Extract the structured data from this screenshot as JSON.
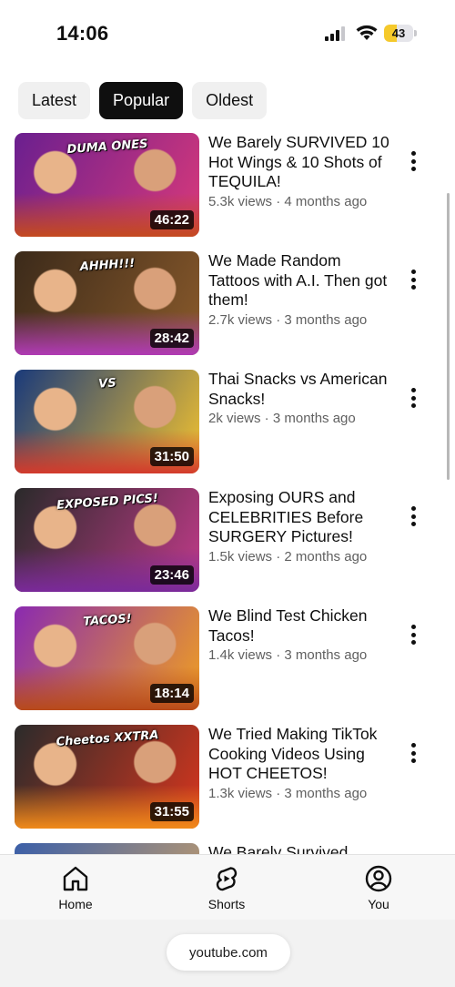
{
  "status_bar": {
    "time": "14:06",
    "battery": "43",
    "battery_level": 0.43
  },
  "chips": [
    {
      "label": "Latest",
      "active": false
    },
    {
      "label": "Popular",
      "active": true
    },
    {
      "label": "Oldest",
      "active": false
    }
  ],
  "videos": [
    {
      "title": "We Barely SURVIVED 10 Hot Wings & 10 Shots of TEQUILA!",
      "stats": "5.3k views · 4 months ago",
      "duration": "46:22",
      "thumb_text": "DUMA ONES",
      "thumb_colors": [
        "#6a1f8f",
        "#d9397a",
        "#c44a1f"
      ]
    },
    {
      "title": "We Made Random Tattoos with A.I. Then got them!",
      "stats": "2.7k views · 3 months ago",
      "duration": "28:42",
      "thumb_text": "AHHH!!!",
      "thumb_colors": [
        "#3b2a1a",
        "#8a5a2b",
        "#b03ab5"
      ]
    },
    {
      "title": "Thai Snacks vs American Snacks!",
      "stats": "2k views · 3 months ago",
      "duration": "31:50",
      "thumb_text": "VS",
      "thumb_colors": [
        "#1a3a7a",
        "#f2c230",
        "#d33a2c"
      ]
    },
    {
      "title": "Exposing OURS and CELEBRITIES Before SURGERY Pictures!",
      "stats": "1.5k views · 2 months ago",
      "duration": "23:46",
      "thumb_text": "EXPOSED PICS!",
      "thumb_colors": [
        "#2a2a2a",
        "#c23b8a",
        "#7a2a9a"
      ]
    },
    {
      "title": "We Blind Test Chicken Tacos!",
      "stats": "1.4k views · 3 months ago",
      "duration": "18:14",
      "thumb_text": "TACOS!",
      "thumb_colors": [
        "#8a2ab0",
        "#f0a020",
        "#b84a1a"
      ]
    },
    {
      "title": "We Tried Making TikTok Cooking Videos Using HOT CHEETOS!",
      "stats": "1.3k views · 3 months ago",
      "duration": "31:55",
      "thumb_text": "Cheetos XXTRA",
      "thumb_colors": [
        "#2b2b2b",
        "#d8361e",
        "#f08a1a"
      ]
    },
    {
      "title": "We Barely Survived",
      "stats": "",
      "duration": "",
      "thumb_text": "",
      "thumb_colors": [
        "#3b5fa8",
        "#c9a06a",
        "#3a2a2a"
      ]
    }
  ],
  "bottom_nav": [
    {
      "label": "Home",
      "icon": "home-icon"
    },
    {
      "label": "Shorts",
      "icon": "shorts-icon"
    },
    {
      "label": "You",
      "icon": "you-icon"
    }
  ],
  "browser": {
    "url": "youtube.com"
  }
}
